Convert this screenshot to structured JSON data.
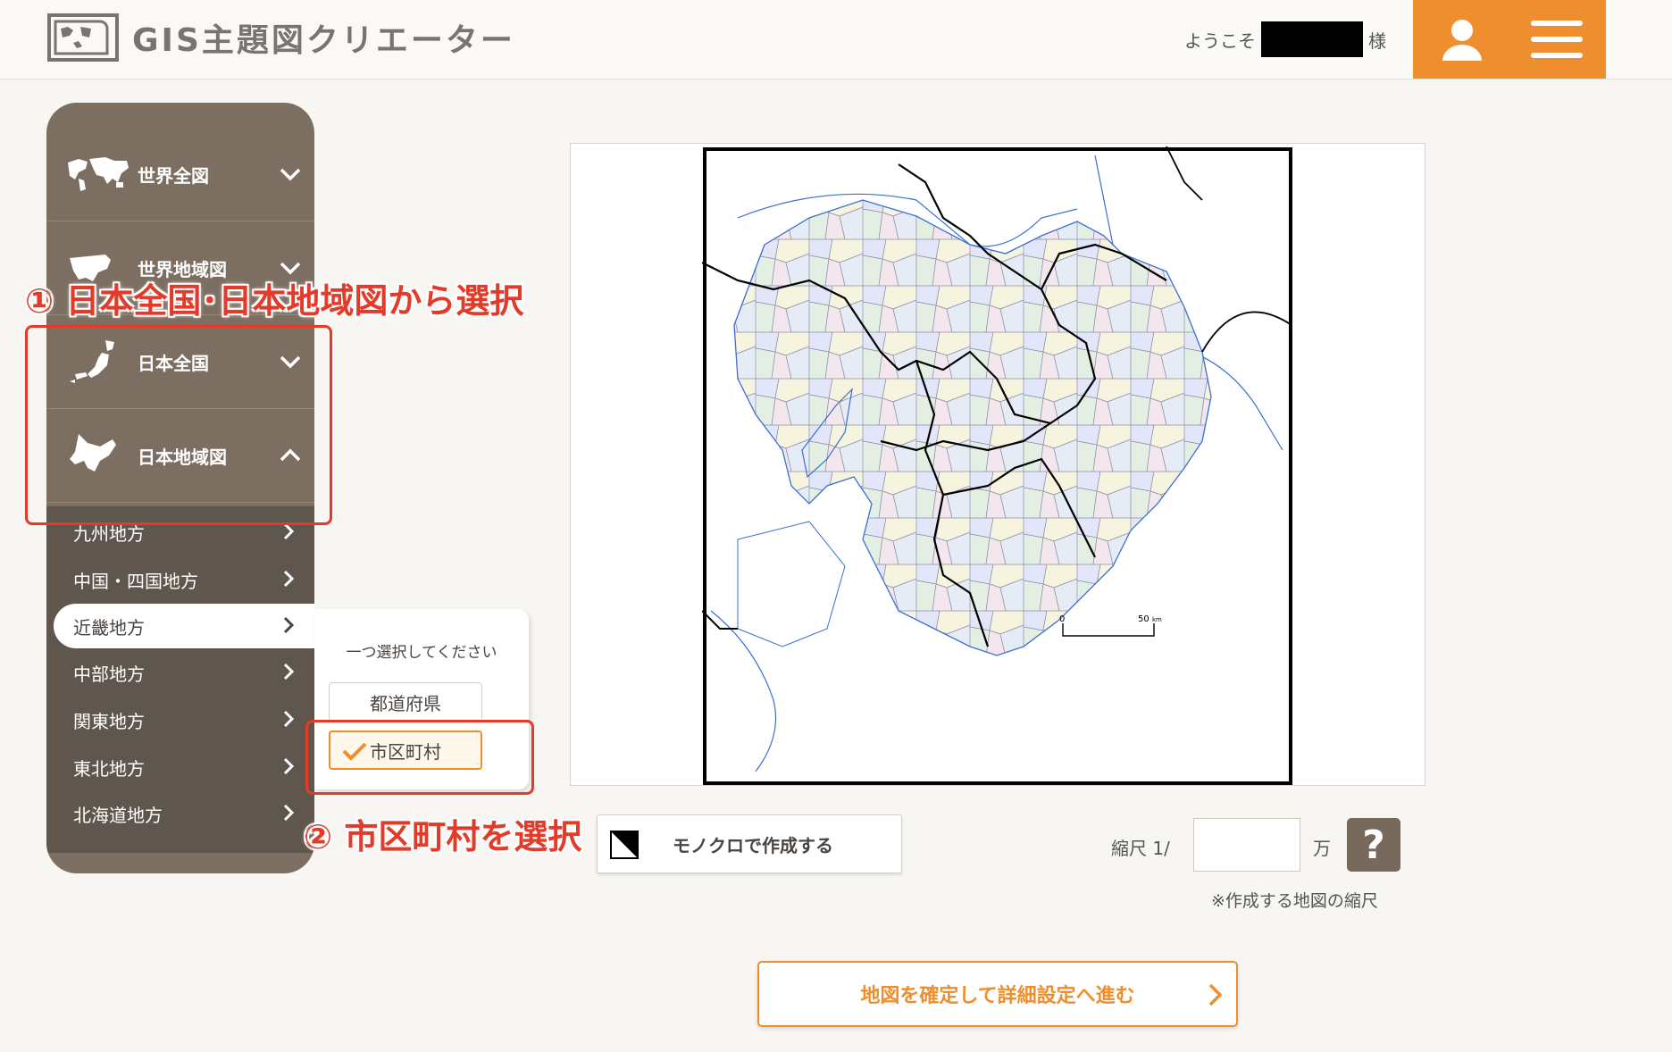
{
  "header": {
    "app_title": "GIS主題図クリエーター",
    "welcome": "ようこそ",
    "honorific": "様",
    "user_icon": "user-icon",
    "menu_icon": "hamburger-menu-icon",
    "accent": "#ee8e2e"
  },
  "sidebar": {
    "categories": [
      {
        "label": "世界全図",
        "icon": "world-map-icon",
        "state": "collapsed"
      },
      {
        "label": "世界地域図",
        "icon": "americas-map-icon",
        "state": "collapsed"
      },
      {
        "label": "日本全国",
        "icon": "japan-map-icon",
        "state": "collapsed"
      },
      {
        "label": "日本地域図",
        "icon": "hokkaido-map-icon",
        "state": "expanded"
      }
    ],
    "regions": [
      {
        "label": "九州地方"
      },
      {
        "label": "中国・四国地方"
      },
      {
        "label": "近畿地方",
        "active": true
      },
      {
        "label": "中部地方"
      },
      {
        "label": "関東地方"
      },
      {
        "label": "東北地方"
      },
      {
        "label": "北海道地方"
      }
    ]
  },
  "popup": {
    "title": "一つ選択してください",
    "options": [
      {
        "label": "都道府県",
        "selected": false
      },
      {
        "label": "市区町村",
        "selected": true
      }
    ]
  },
  "map": {
    "scale_bar": {
      "zero": "0",
      "fifty": "50",
      "unit": "km"
    }
  },
  "controls": {
    "mono_label": "モノクロで作成する",
    "scale_label": "縮尺 1/",
    "scale_value": "",
    "scale_unit": "万",
    "help_label": "?",
    "scale_note": "※作成する地図の縮尺",
    "confirm_label": "地図を確定して詳細設定へ進む"
  },
  "annotations": {
    "step1": "① 日本全国･日本地域図から選択",
    "step2": "② 市区町村を選択",
    "color": "#e23b2a"
  }
}
